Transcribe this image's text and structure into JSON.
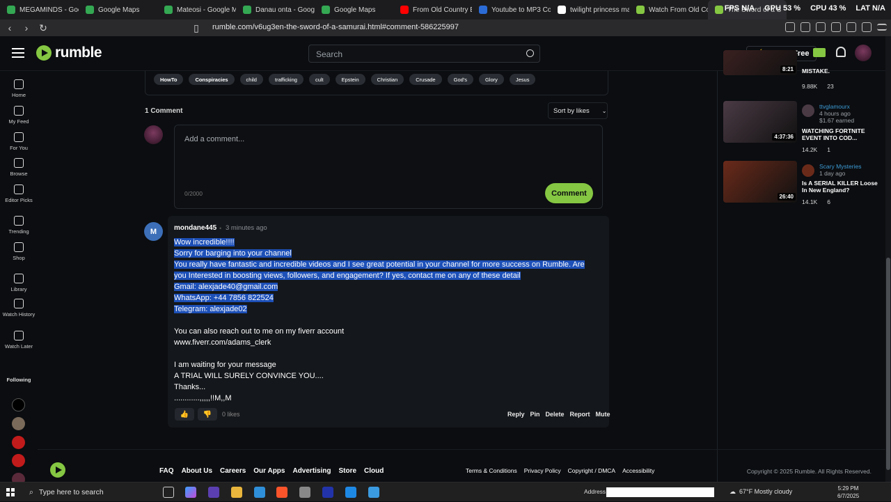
{
  "browser": {
    "tabs": [
      {
        "title": "MEGAMINDS - Google",
        "color": "#34a853"
      },
      {
        "title": "Google Maps",
        "color": "#34a853"
      },
      {
        "title": "Mateosi - Google Maps",
        "color": "#34a853"
      },
      {
        "title": "Danau onta - Google",
        "color": "#34a853"
      },
      {
        "title": "Google Maps",
        "color": "#34a853"
      },
      {
        "title": "From Old Country Bun",
        "color": "#ff0000"
      },
      {
        "title": "Youtube to MP3 Conv",
        "color": "#2b6bd6"
      },
      {
        "title": "twilight princess mast",
        "color": "#ffffff"
      },
      {
        "title": "Watch From Old Coun",
        "color": "#85c742"
      },
      {
        "title": "The Sword of a S",
        "color": "#85c742"
      }
    ],
    "perf": {
      "fps": "FPS N/A",
      "gpu": "GPU 53 %",
      "cpu": "CPU 43 %",
      "lat": "LAT N/A"
    },
    "url": "rumble.com/v6ug3en-the-sword-of-a-samurai.html#comment-586225997"
  },
  "header": {
    "logo_text": "rumble",
    "search_placeholder": "Search",
    "go_adfree": "Go Ad-Free"
  },
  "left_nav": {
    "items": [
      {
        "label": "Home",
        "icon": "home-icon"
      },
      {
        "label": "My Feed",
        "icon": "feed-icon"
      },
      {
        "label": "For You",
        "icon": "target-icon"
      },
      {
        "label": "Browse",
        "icon": "browse-icon"
      },
      {
        "label": "Editor Picks",
        "icon": "trophy-icon"
      },
      {
        "label": "Trending",
        "icon": "trending-icon"
      },
      {
        "label": "Shop",
        "icon": "shop-icon"
      },
      {
        "label": "Library",
        "icon": "library-icon"
      },
      {
        "label": "Watch History",
        "icon": "history-icon"
      },
      {
        "label": "Watch Later",
        "icon": "clock-icon"
      }
    ],
    "following_label": "Following"
  },
  "tags": [
    "HowTo",
    "Conspiracies",
    "child",
    "trafficking",
    "cult",
    "Epstein",
    "Christian",
    "Crusade",
    "God's",
    "Glory",
    "Jesus"
  ],
  "comments": {
    "count_label": "1 Comment",
    "sort_label": "Sort by likes",
    "compose_placeholder": "Add a comment...",
    "char_count": "0/2000",
    "comment_button": "Comment",
    "item": {
      "avatar_letter": "M",
      "author": "mondane445",
      "time": "3 minutes ago",
      "lines": [
        "Wow incredible!!!!",
        "Sorry for barging into your channel",
        "You really have fantastic and incredible videos and I see great potential in your channel for more success on Rumble. Are",
        "you Interested in boosting views, followers, and engagement? If yes, contact me on any of these detail",
        "Gmail: alexjade40@gmail.com",
        "WhatsApp: +44 7856 822524",
        "Telegram: alexjade02",
        "You can also reach out to me on my fiverr account",
        "www.fiverr.com/adams_clerk",
        "I am waiting for your message",
        "A TRIAL WILL SURELY CONVINCE YOU....",
        "Thanks...",
        "............,,,,,!!M,,M"
      ],
      "likes": "0 likes",
      "actions": [
        "Reply",
        "Pin",
        "Delete",
        "Report",
        "Mute"
      ]
    }
  },
  "sidebar_videos": [
    {
      "duration": "8:21",
      "channel": "",
      "meta": "",
      "earned": "",
      "title": "MISTAKE.",
      "views": "9.88K",
      "comments": "23",
      "thumb": "#3a2020"
    },
    {
      "duration": "4:37:36",
      "channel": "ttvglamourx",
      "meta": "4 hours ago",
      "earned": "$1.67 earned",
      "title": "WATCHING FORTNITE EVENT INTO COD...",
      "views": "14.2K",
      "comments": "1",
      "thumb": "#4a3a44"
    },
    {
      "duration": "26:40",
      "channel": "Scary Mysteries",
      "meta": "1 day ago",
      "earned": "",
      "title": "Is A SERIAL KILLER Loose In New England?",
      "views": "14.1K",
      "comments": "6",
      "thumb": "#6a2a1a"
    }
  ],
  "footer": {
    "links": [
      "FAQ",
      "About Us",
      "Careers",
      "Our Apps",
      "Advertising",
      "Store",
      "Cloud"
    ],
    "legal": [
      "Terms & Conditions",
      "Privacy Policy",
      "Copyright / DMCA",
      "Accessibility"
    ],
    "copyright": "Copyright © 2025 Rumble. All Rights Reserved."
  },
  "taskbar": {
    "search": "Type here to search",
    "address_label": "Address",
    "weather": "67°F  Mostly cloudy",
    "time": "5:29 PM",
    "date": "6/7/2025"
  },
  "colors": {
    "accent": "#85c742",
    "selection": "#1d50b8",
    "avatar_m": "#3c6fb8"
  }
}
